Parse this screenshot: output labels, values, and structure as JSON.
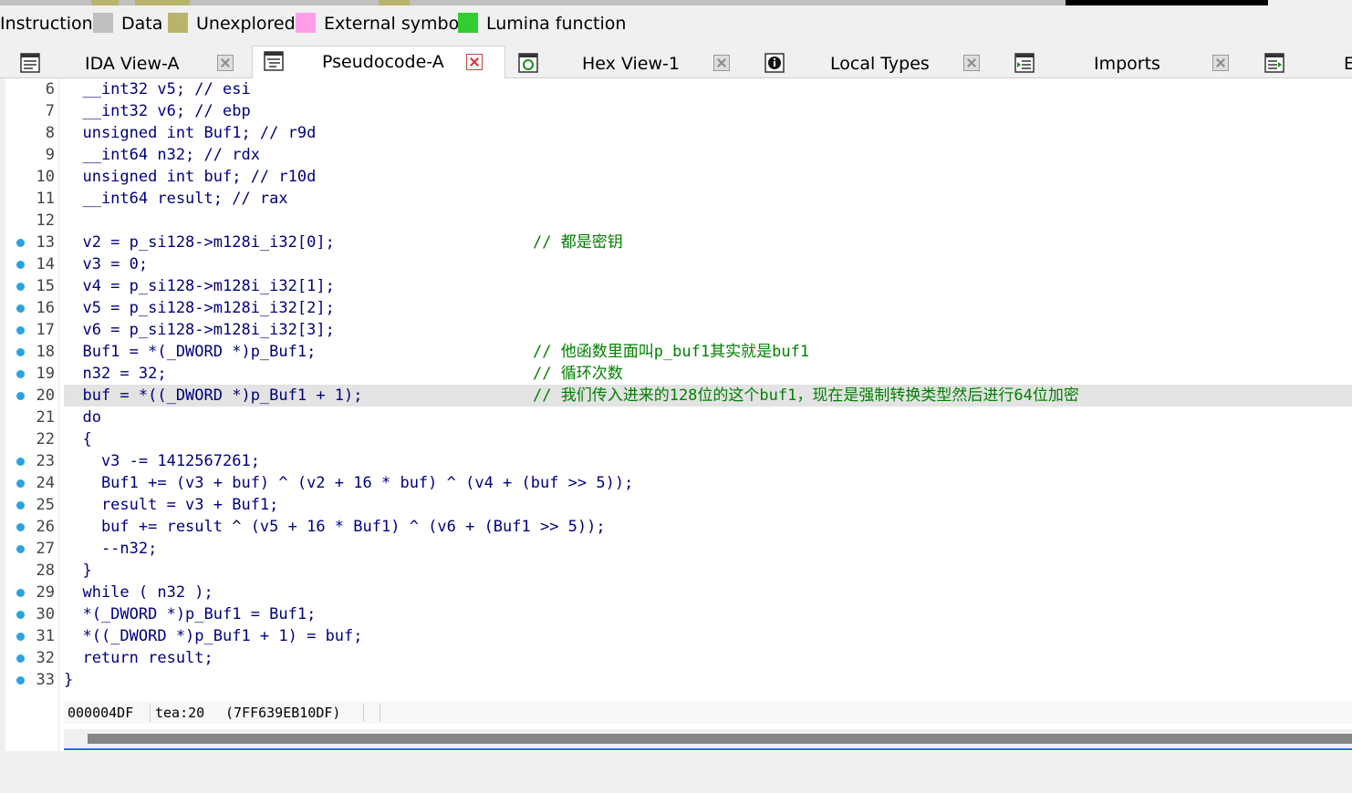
{
  "legend": {
    "items": [
      {
        "label": "Instruction",
        "color": null
      },
      {
        "label": "Data",
        "color": "#c0c0c0"
      },
      {
        "label": "Unexplored",
        "color": "#b8b46a"
      },
      {
        "label": "External symbol",
        "color": "#ff9ee8"
      },
      {
        "label": "Lumina function",
        "color": "#33cc33"
      }
    ]
  },
  "tabs": [
    {
      "label": "IDA View-A",
      "icon": "disassembly-icon",
      "active": false
    },
    {
      "label": "Pseudocode-A",
      "icon": "pseudocode-icon",
      "active": true
    },
    {
      "label": "Hex View-1",
      "icon": "hex-view-icon",
      "active": false
    },
    {
      "label": "Local Types",
      "icon": "local-types-icon",
      "active": false
    },
    {
      "label": "Imports",
      "icon": "imports-icon",
      "active": false
    },
    {
      "label": "E",
      "icon": "exports-icon",
      "active": false
    }
  ],
  "code": {
    "lines": [
      {
        "n": "6",
        "dot": false,
        "text": "  __int32 v5; // esi",
        "comment": ""
      },
      {
        "n": "7",
        "dot": false,
        "text": "  __int32 v6; // ebp",
        "comment": ""
      },
      {
        "n": "8",
        "dot": false,
        "text": "  unsigned int Buf1; // r9d",
        "comment": ""
      },
      {
        "n": "9",
        "dot": false,
        "text": "  __int64 n32; // rdx",
        "comment": ""
      },
      {
        "n": "10",
        "dot": false,
        "text": "  unsigned int buf; // r10d",
        "comment": ""
      },
      {
        "n": "11",
        "dot": false,
        "text": "  __int64 result; // rax",
        "comment": ""
      },
      {
        "n": "12",
        "dot": false,
        "text": "",
        "comment": ""
      },
      {
        "n": "13",
        "dot": true,
        "text": "  v2 = p_si128->m128i_i32[0];",
        "comment": "// 都是密钥"
      },
      {
        "n": "14",
        "dot": true,
        "text": "  v3 = 0;",
        "comment": ""
      },
      {
        "n": "15",
        "dot": true,
        "text": "  v4 = p_si128->m128i_i32[1];",
        "comment": ""
      },
      {
        "n": "16",
        "dot": true,
        "text": "  v5 = p_si128->m128i_i32[2];",
        "comment": ""
      },
      {
        "n": "17",
        "dot": true,
        "text": "  v6 = p_si128->m128i_i32[3];",
        "comment": ""
      },
      {
        "n": "18",
        "dot": true,
        "text": "  Buf1 = *(_DWORD *)p_Buf1;",
        "comment": "// 他函数里面叫p_buf1其实就是buf1"
      },
      {
        "n": "19",
        "dot": true,
        "text": "  n32 = 32;",
        "comment": "// 循环次数"
      },
      {
        "n": "20",
        "dot": true,
        "text": "  buf = *((_DWORD *)p_Buf1 + 1);",
        "comment": "// 我们传入进来的128位的这个buf1，现在是强制转换类型然后进行64位加密",
        "highlight": true
      },
      {
        "n": "21",
        "dot": false,
        "text": "  do",
        "comment": ""
      },
      {
        "n": "22",
        "dot": false,
        "text": "  {",
        "comment": ""
      },
      {
        "n": "23",
        "dot": true,
        "text": "    v3 -= 1412567261;",
        "comment": ""
      },
      {
        "n": "24",
        "dot": true,
        "text": "    Buf1 += (v3 + buf) ^ (v2 + 16 * buf) ^ (v4 + (buf >> 5));",
        "comment": ""
      },
      {
        "n": "25",
        "dot": true,
        "text": "    result = v3 + Buf1;",
        "comment": ""
      },
      {
        "n": "26",
        "dot": true,
        "text": "    buf += result ^ (v5 + 16 * Buf1) ^ (v6 + (Buf1 >> 5));",
        "comment": ""
      },
      {
        "n": "27",
        "dot": true,
        "text": "    --n32;",
        "comment": ""
      },
      {
        "n": "28",
        "dot": false,
        "text": "  }",
        "comment": ""
      },
      {
        "n": "29",
        "dot": true,
        "text": "  while ( n32 );",
        "comment": ""
      },
      {
        "n": "30",
        "dot": true,
        "text": "  *(_DWORD *)p_Buf1 = Buf1;",
        "comment": ""
      },
      {
        "n": "31",
        "dot": true,
        "text": "  *((_DWORD *)p_Buf1 + 1) = buf;",
        "comment": ""
      },
      {
        "n": "32",
        "dot": true,
        "text": "  return result;",
        "comment": ""
      },
      {
        "n": "33",
        "dot": true,
        "text": "}",
        "comment": ""
      }
    ]
  },
  "status": {
    "offset": "000004DF",
    "location": "tea:20",
    "address": "(7FF639EB10DF)"
  },
  "colors": {
    "breakpoint_dot": "#29a3e0",
    "comment": "#008000",
    "code": "#000080",
    "current_line": "#e3e3e3"
  }
}
